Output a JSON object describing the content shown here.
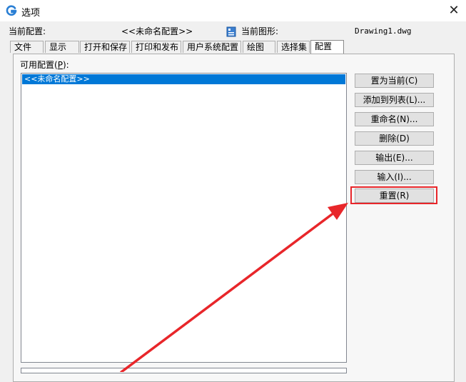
{
  "window": {
    "title": "选项",
    "close_glyph": "✕"
  },
  "info": {
    "current_profile_label": "当前配置:",
    "current_profile_value": "<<未命名配置>>",
    "current_drawing_label": "当前图形:",
    "current_drawing_value": "Drawing1.dwg"
  },
  "tabs": [
    {
      "label": "文件",
      "active": false
    },
    {
      "label": "显示",
      "active": false
    },
    {
      "label": "打开和保存",
      "active": false
    },
    {
      "label": "打印和发布",
      "active": false
    },
    {
      "label": "用户系统配置",
      "active": false
    },
    {
      "label": "绘图",
      "active": false
    },
    {
      "label": "选择集",
      "active": false
    },
    {
      "label": "配置",
      "active": true
    }
  ],
  "profiles": {
    "label": "可用配置(P):",
    "items": [
      "<<未命名配置>>"
    ],
    "selected_index": 0
  },
  "buttons": {
    "set_current": "置为当前(C)",
    "add_to_list": "添加到列表(L)...",
    "rename": "重命名(N)...",
    "delete": "删除(D)",
    "export": "输出(E)...",
    "import": "输入(I)...",
    "reset": "重置(R)"
  },
  "icons": {
    "app": "app-logo-icon",
    "drawing": "drawing-file-icon",
    "close": "close-icon"
  },
  "colors": {
    "accent_selection": "#0078d7",
    "annotation_red": "#e8262a",
    "app_icon_blue": "#2a7fd4"
  }
}
